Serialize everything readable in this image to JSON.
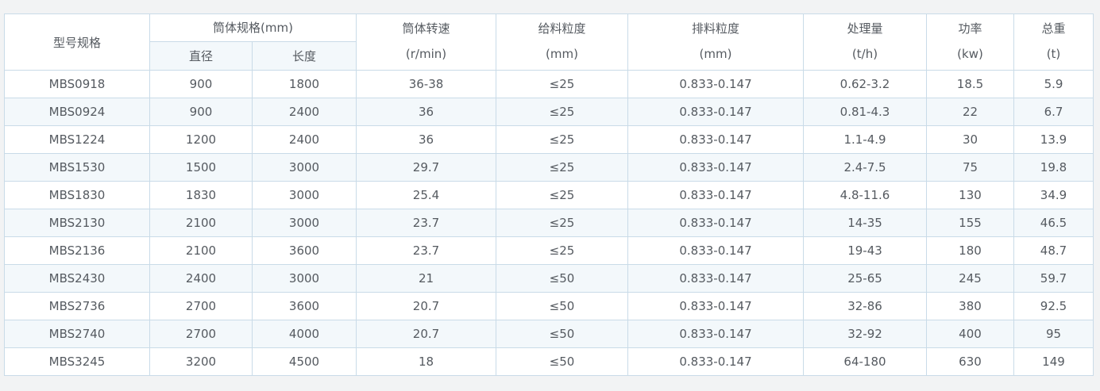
{
  "headers": {
    "model": "型号规格",
    "cylinder_spec": "筒体规格(mm)",
    "diameter": "直径",
    "length": "长度",
    "speed_line1": "筒体转速",
    "speed_line2": "(r/min)",
    "feed_line1": "给料粒度",
    "feed_line2": "(mm)",
    "discharge_line1": "排料粒度",
    "discharge_line2": "(mm)",
    "capacity_line1": "处理量",
    "capacity_line2": "(t/h)",
    "power_line1": "功率",
    "power_line2": "(kw)",
    "weight_line1": "总重",
    "weight_line2": "(t)"
  },
  "rows": [
    [
      "MBS0918",
      "900",
      "1800",
      "36-38",
      "≤25",
      "0.833-0.147",
      "0.62-3.2",
      "18.5",
      "5.9"
    ],
    [
      "MBS0924",
      "900",
      "2400",
      "36",
      "≤25",
      "0.833-0.147",
      "0.81-4.3",
      "22",
      "6.7"
    ],
    [
      "MBS1224",
      "1200",
      "2400",
      "36",
      "≤25",
      "0.833-0.147",
      "1.1-4.9",
      "30",
      "13.9"
    ],
    [
      "MBS1530",
      "1500",
      "3000",
      "29.7",
      "≤25",
      "0.833-0.147",
      "2.4-7.5",
      "75",
      "19.8"
    ],
    [
      "MBS1830",
      "1830",
      "3000",
      "25.4",
      "≤25",
      "0.833-0.147",
      "4.8-11.6",
      "130",
      "34.9"
    ],
    [
      "MBS2130",
      "2100",
      "3000",
      "23.7",
      "≤25",
      "0.833-0.147",
      "14-35",
      "155",
      "46.5"
    ],
    [
      "MBS2136",
      "2100",
      "3600",
      "23.7",
      "≤25",
      "0.833-0.147",
      "19-43",
      "180",
      "48.7"
    ],
    [
      "MBS2430",
      "2400",
      "3000",
      "21",
      "≤50",
      "0.833-0.147",
      "25-65",
      "245",
      "59.7"
    ],
    [
      "MBS2736",
      "2700",
      "3600",
      "20.7",
      "≤50",
      "0.833-0.147",
      "32-86",
      "380",
      "92.5"
    ],
    [
      "MBS2740",
      "2700",
      "4000",
      "20.7",
      "≤50",
      "0.833-0.147",
      "32-92",
      "400",
      "95"
    ],
    [
      "MBS3245",
      "3200",
      "4500",
      "18",
      "≤50",
      "0.833-0.147",
      "64-180",
      "630",
      "149"
    ]
  ],
  "colors": {
    "border": "#c9dbe8",
    "stripe": "#f3f8fb",
    "text": "#555a60",
    "background": "#f2f3f4"
  }
}
